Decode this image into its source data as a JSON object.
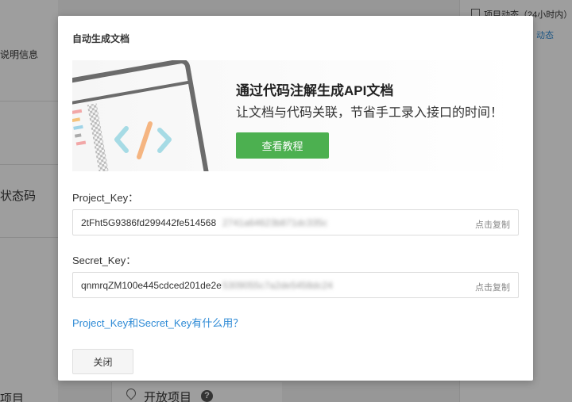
{
  "background": {
    "left_label_1": "说明信息",
    "left_label_2": "状态码",
    "left_label_3": "项目",
    "right_header": "项目动态（24小时内）",
    "right_link": "动态",
    "bottom_label": "开放项目",
    "help_icon": "question-circle-icon"
  },
  "modal": {
    "title": "自动生成文档",
    "banner": {
      "title": "通过代码注解生成API文档",
      "subtitle": "让文档与代码关联，节省手工录入接口的时间！",
      "tutorial_button": "查看教程"
    },
    "project_key": {
      "label": "Project_Key：",
      "value": "2tFht5G9386fd299442fe514568",
      "blurred": "2741a64623b871dc335c",
      "copy": "点击复制"
    },
    "secret_key": {
      "label": "Secret_Key：",
      "value": "qnmrqZM100e445cdced201de2e",
      "blurred": "5309055c7a2de5458dc24",
      "copy": "点击复制"
    },
    "help_link": "Project_Key和Secret_Key有什么用？",
    "close_button": "关闭"
  },
  "colors": {
    "accent_green": "#4cb050",
    "link_blue": "#2f8bd6"
  }
}
